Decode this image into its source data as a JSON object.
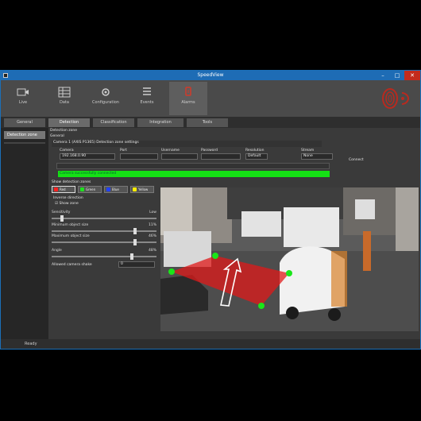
{
  "window": {
    "title": "SpeedView",
    "controls": {
      "minimize": "–",
      "maximize": "□",
      "close": "✕"
    }
  },
  "ribbon": {
    "buttons": [
      {
        "label": "Live",
        "icon": "video-icon"
      },
      {
        "label": "Data",
        "icon": "table-icon"
      },
      {
        "label": "Configuration",
        "icon": "settings-icon"
      },
      {
        "label": "Events",
        "icon": "list-icon"
      },
      {
        "label": "Alarms",
        "icon": "alarm-icon",
        "active": true
      }
    ],
    "accent_color": "#c0392b"
  },
  "tabs": [
    {
      "label": "General"
    },
    {
      "label": "Detection",
      "active": true
    },
    {
      "label": "Classification"
    },
    {
      "label": "Integration"
    },
    {
      "label": "Tools"
    }
  ],
  "left_panel": {
    "items": [
      {
        "label": "Detection zone"
      }
    ]
  },
  "detection": {
    "section_label": "Detection zone",
    "subheader": "General",
    "camera_row_label": "Camera 1 (AXIS P1365) Detection zone settings",
    "fields": [
      {
        "label": "Camera",
        "value": "192.168.0.90"
      },
      {
        "label": "Port",
        "value": ""
      },
      {
        "label": "Username",
        "value": ""
      },
      {
        "label": "Password",
        "value": ""
      },
      {
        "label": "Resolution",
        "value": "Default"
      },
      {
        "label": "Stream",
        "value": "None"
      }
    ],
    "apply_label": "Connect",
    "status_text": "Camera successfully connected",
    "status_color": "#15e015",
    "zone_header": "Show detection zones",
    "zone_colors": [
      {
        "label": "Red",
        "color": "#ff2020"
      },
      {
        "label": "Green",
        "color": "#20e020"
      },
      {
        "label": "Blue",
        "color": "#2040ff"
      },
      {
        "label": "Yellow",
        "color": "#ffee00"
      }
    ],
    "options": [
      "Inverse direction",
      "Show zone"
    ],
    "sliders": [
      {
        "label": "Sensitivity",
        "value": "Low",
        "level": 0.08
      },
      {
        "label": "Minimum object size",
        "value": "11%",
        "level": 0.78
      },
      {
        "label": "Maximum object size",
        "value": "46%",
        "level": 0.78
      },
      {
        "label": "Angle",
        "value": "48%",
        "level": 0.75
      }
    ],
    "footer_label": "Allowed camera shake",
    "footer_value": "0"
  },
  "statusbar": {
    "text": "Ready"
  }
}
